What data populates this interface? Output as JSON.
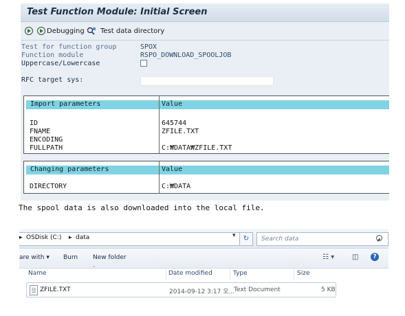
{
  "sap": {
    "title": "Test Function Module: Initial Screen",
    "toolbar": {
      "debugging_label": "Debugging",
      "test_data_label": "Test data directory"
    },
    "fields": {
      "test_group_label": "Test for function group",
      "test_group_value": "SPOX",
      "function_module_label": "Function module",
      "function_module_value": "RSPO_DOWNLOAD_SPOOLJOB",
      "uppercase_label": "Uppercase/Lowercase",
      "rfc_label": "RFC target sys:"
    },
    "import_table": {
      "header_param": "Import parameters",
      "header_value": "Value",
      "rows": [
        {
          "name": "ID",
          "value": "645744"
        },
        {
          "name": "FNAME",
          "value": "ZFILE.TXT"
        },
        {
          "name": "ENCODING",
          "value": ""
        },
        {
          "name": "FULLPATH",
          "value": "C:₩DATA₩ZFILE.TXT"
        }
      ]
    },
    "changing_table": {
      "header_param": "Changing parameters",
      "header_value": "Value",
      "rows": [
        {
          "name": "DIRECTORY",
          "value": "C:₩DATA"
        }
      ]
    }
  },
  "caption": "The spool data is also downloaded into the local file.",
  "explorer": {
    "breadcrumb": {
      "disk": "OSDisk (C:)",
      "folder": "data"
    },
    "search_placeholder": "Search data",
    "commands": {
      "share": "are with",
      "burn": "Burn",
      "new_folder": "New folder"
    },
    "columns": {
      "name": "Name",
      "date": "Date modified",
      "type": "Type",
      "size": "Size"
    },
    "files": [
      {
        "name": "ZFILE.TXT",
        "date": "2014-09-12 3:17 오...",
        "type": "Text Document",
        "size": "5 KB"
      }
    ]
  }
}
